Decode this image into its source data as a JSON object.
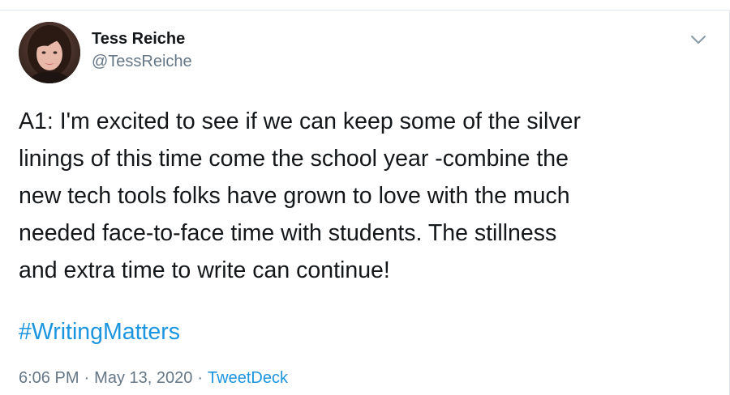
{
  "tweet": {
    "author": {
      "display_name": "Tess Reiche",
      "handle": "@TessReiche"
    },
    "menu_icon": "chevron-down-icon",
    "text_lines": [
      "A1: I'm excited to see if we can keep some of the silver",
      "linings of this time come the school year -combine the",
      "new tech tools folks have grown to love with the much",
      "needed face-to-face time with students. The stillness",
      "and extra time to write can continue!"
    ],
    "hashtag": "#WritingMatters",
    "meta": {
      "time": "6:06 PM",
      "separator": "·",
      "date": "May 13, 2020",
      "source": "TweetDeck"
    }
  },
  "colors": {
    "text": "#14171a",
    "secondary": "#657786",
    "link": "#1b95e0",
    "border": "#e1e8ed"
  }
}
